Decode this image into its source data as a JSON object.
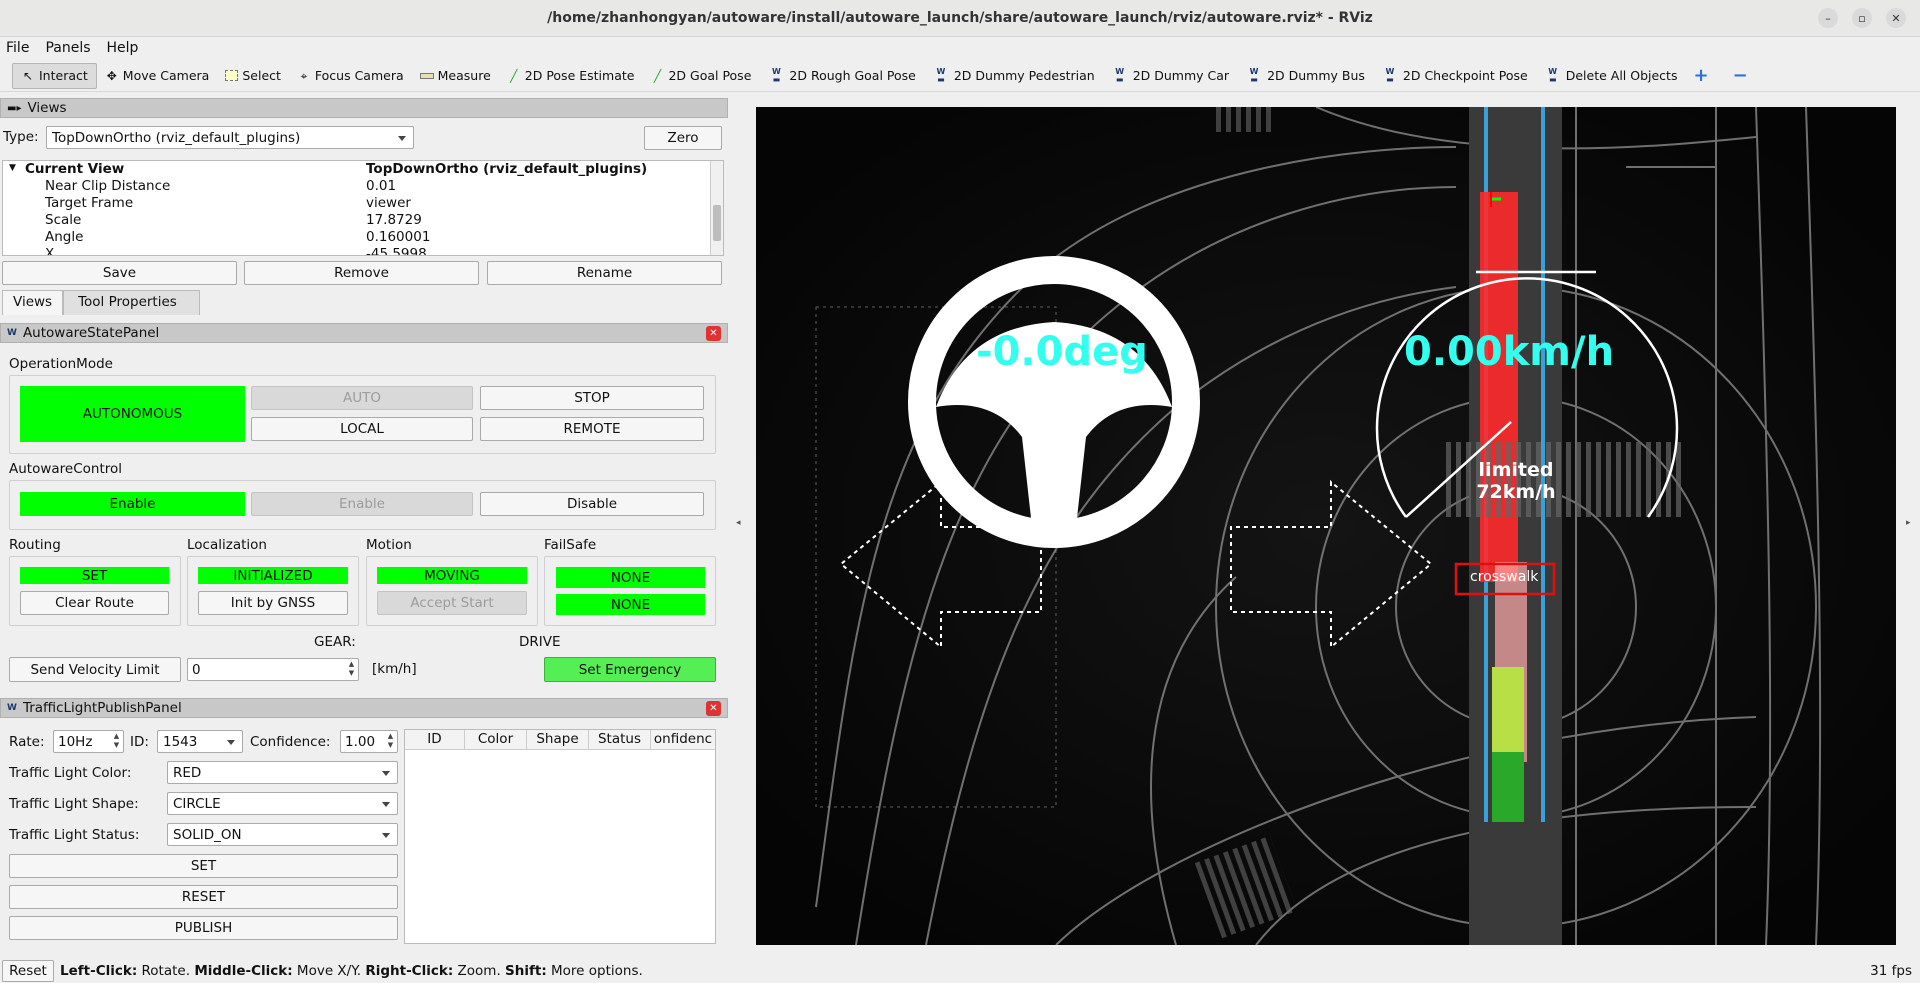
{
  "window": {
    "title": "/home/zhanhongyan/autoware/install/autoware_launch/share/autoware_launch/rviz/autoware.rviz* - RViz"
  },
  "menu": [
    "File",
    "Panels",
    "Help"
  ],
  "toolbar": {
    "items": [
      {
        "label": "Interact",
        "icon": "cursor-icon"
      },
      {
        "label": "Move Camera",
        "icon": "move-icon"
      },
      {
        "label": "Select",
        "icon": "select-icon"
      },
      {
        "label": "Focus Camera",
        "icon": "focus-icon"
      },
      {
        "label": "Measure",
        "icon": "ruler-icon"
      },
      {
        "label": "2D Pose Estimate",
        "icon": "pose-arrow-icon"
      },
      {
        "label": "2D Goal Pose",
        "icon": "pose-arrow-icon"
      },
      {
        "label": "2D Rough Goal Pose",
        "icon": "autoware-icon"
      },
      {
        "label": "2D Dummy Pedestrian",
        "icon": "autoware-icon"
      },
      {
        "label": "2D Dummy Car",
        "icon": "autoware-icon"
      },
      {
        "label": "2D Dummy Bus",
        "icon": "autoware-icon"
      },
      {
        "label": "2D Checkpoint Pose",
        "icon": "autoware-icon"
      },
      {
        "label": "Delete All Objects",
        "icon": "autoware-icon"
      }
    ],
    "plus": "+",
    "minus": "−"
  },
  "views_panel": {
    "title": "Views",
    "type_label": "Type:",
    "type_value": "TopDownOrtho (rviz_default_plugins)",
    "zero_button": "Zero",
    "tree": [
      {
        "key": "Current View",
        "value": "TopDownOrtho (rviz_default_plugins)"
      },
      {
        "key": "Near Clip Distance",
        "value": "0.01"
      },
      {
        "key": "Target Frame",
        "value": "viewer"
      },
      {
        "key": "Scale",
        "value": "17.8729"
      },
      {
        "key": "Angle",
        "value": "0.160001"
      },
      {
        "key": "X",
        "value": "-45.5998"
      }
    ],
    "save": "Save",
    "remove": "Remove",
    "rename": "Rename",
    "tabs": [
      "Views",
      "Tool Properties"
    ]
  },
  "state_panel": {
    "title": "AutowareStatePanel",
    "operation_mode_label": "OperationMode",
    "mode_status": "AUTONOMOUS",
    "auto": "AUTO",
    "stop": "STOP",
    "local": "LOCAL",
    "remote": "REMOTE",
    "control_label": "AutowareControl",
    "control_status": "Enable",
    "enable": "Enable",
    "disable": "Disable",
    "routing_label": "Routing",
    "routing_status": "SET",
    "clear_route": "Clear Route",
    "localization_label": "Localization",
    "localization_status": "INITIALIZED",
    "init_gnss": "Init by GNSS",
    "motion_label": "Motion",
    "motion_status": "MOVING",
    "accept_start": "Accept Start",
    "failsafe_label": "FailSafe",
    "failsafe_1": "NONE",
    "failsafe_2": "NONE",
    "gear_label": "GEAR:",
    "gear_value": "DRIVE",
    "send_velocity": "Send Velocity Limit",
    "velocity_value": "0",
    "velocity_unit": "[km/h]",
    "set_emergency": "Set Emergency"
  },
  "traffic_panel": {
    "title": "TrafficLightPublishPanel",
    "rate_label": "Rate:",
    "rate_value": "10Hz",
    "id_label": "ID:",
    "id_value": "1543",
    "confidence_label": "Confidence:",
    "confidence_value": "1.00",
    "color_label": "Traffic Light Color:",
    "color_value": "RED",
    "shape_label": "Traffic Light Shape:",
    "shape_value": "CIRCLE",
    "status_label": "Traffic Light Status:",
    "status_value": "SOLID_ON",
    "set": "SET",
    "reset": "RESET",
    "publish": "PUBLISH",
    "columns": [
      "ID",
      "Color",
      "Shape",
      "Status",
      "onfidenc"
    ]
  },
  "viewport": {
    "steering_text": "-0.0deg",
    "speed_text": "0.00km/h",
    "limit_line1": "limited",
    "limit_line2": "72km/h",
    "crosswalk": "crosswalk"
  },
  "statusbar": {
    "reset": "Reset",
    "b1": "Left-Click:",
    "t1": " Rotate. ",
    "b2": "Middle-Click:",
    "t2": " Move X/Y. ",
    "b3": "Right-Click:",
    "t3": " Zoom. ",
    "b4": "Shift:",
    "t4": " More options.",
    "fps": "31 fps"
  },
  "colors": {
    "green": "#00ff00",
    "accent_cyan": "#33ffee",
    "red_lane": "#ff2a2a"
  }
}
